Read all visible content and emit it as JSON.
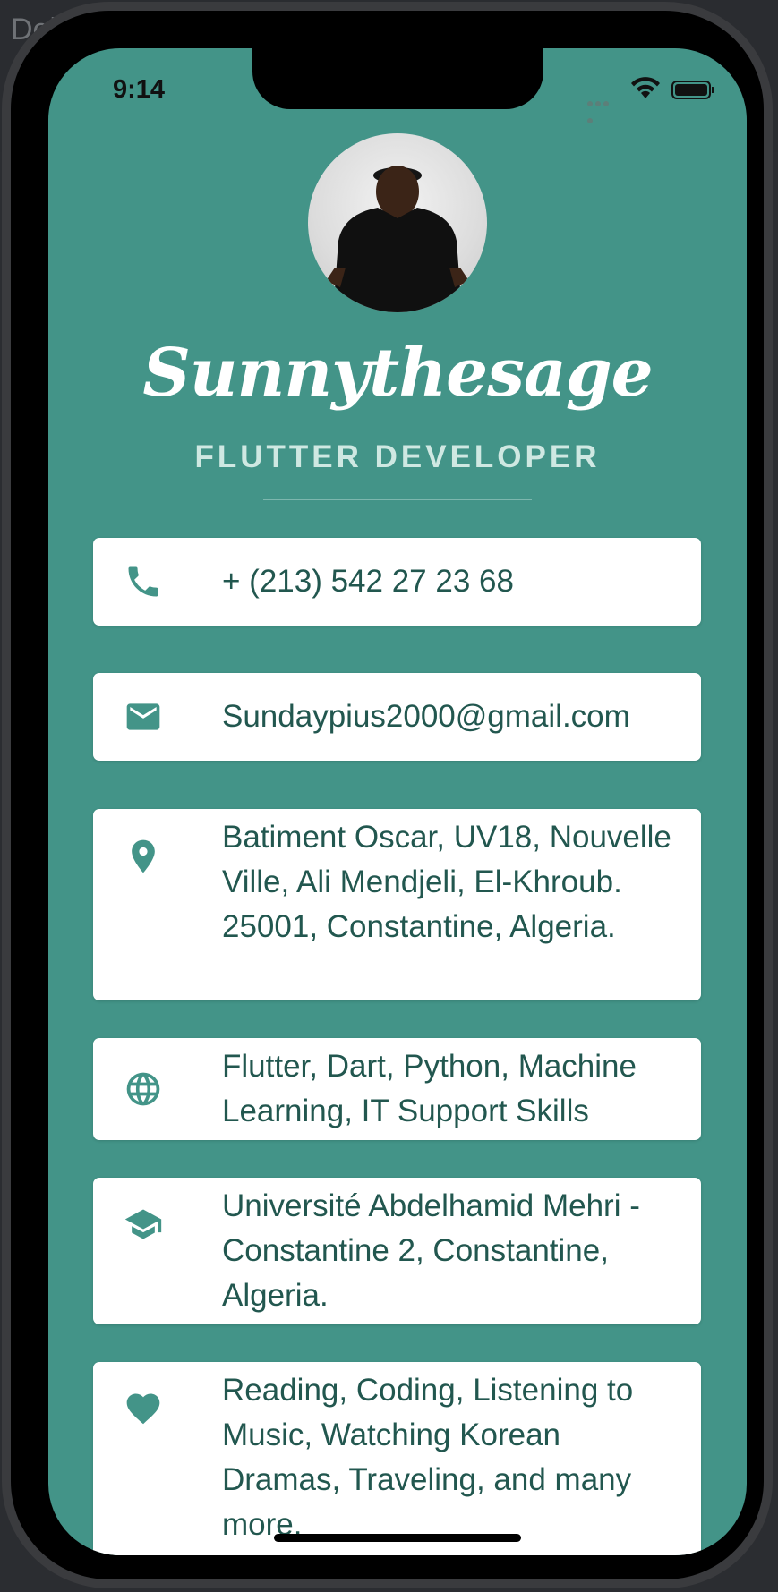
{
  "background": {
    "label": "Deb"
  },
  "status_bar": {
    "time": "9:14"
  },
  "profile": {
    "name": "Sunnythesage",
    "title": "FLUTTER DEVELOPER"
  },
  "cards": [
    {
      "icon": "phone-icon",
      "text": "+ (213) 542 27 23 68"
    },
    {
      "icon": "email-icon",
      "text": "Sundaypius2000@gmail.com"
    },
    {
      "icon": "location-pin-icon",
      "text": "Batiment Oscar, UV18, Nouvelle Ville, Ali Mendjeli, El-Khroub. 25001, Constantine, Algeria."
    },
    {
      "icon": "globe-icon",
      "text": "Flutter, Dart, Python, Machine Learning, IT Support Skills"
    },
    {
      "icon": "graduation-cap-icon",
      "text": "Université Abdelhamid Mehri - Constantine 2, Constantine, Algeria."
    },
    {
      "icon": "heart-icon",
      "text": "Reading, Coding, Listening to Music, Watching Korean Dramas, Traveling, and many more."
    }
  ],
  "colors": {
    "background": "#439488",
    "card": "#ffffff",
    "card_text": "#22574f",
    "icon": "#439488",
    "subtitle": "#cfe8e2"
  }
}
